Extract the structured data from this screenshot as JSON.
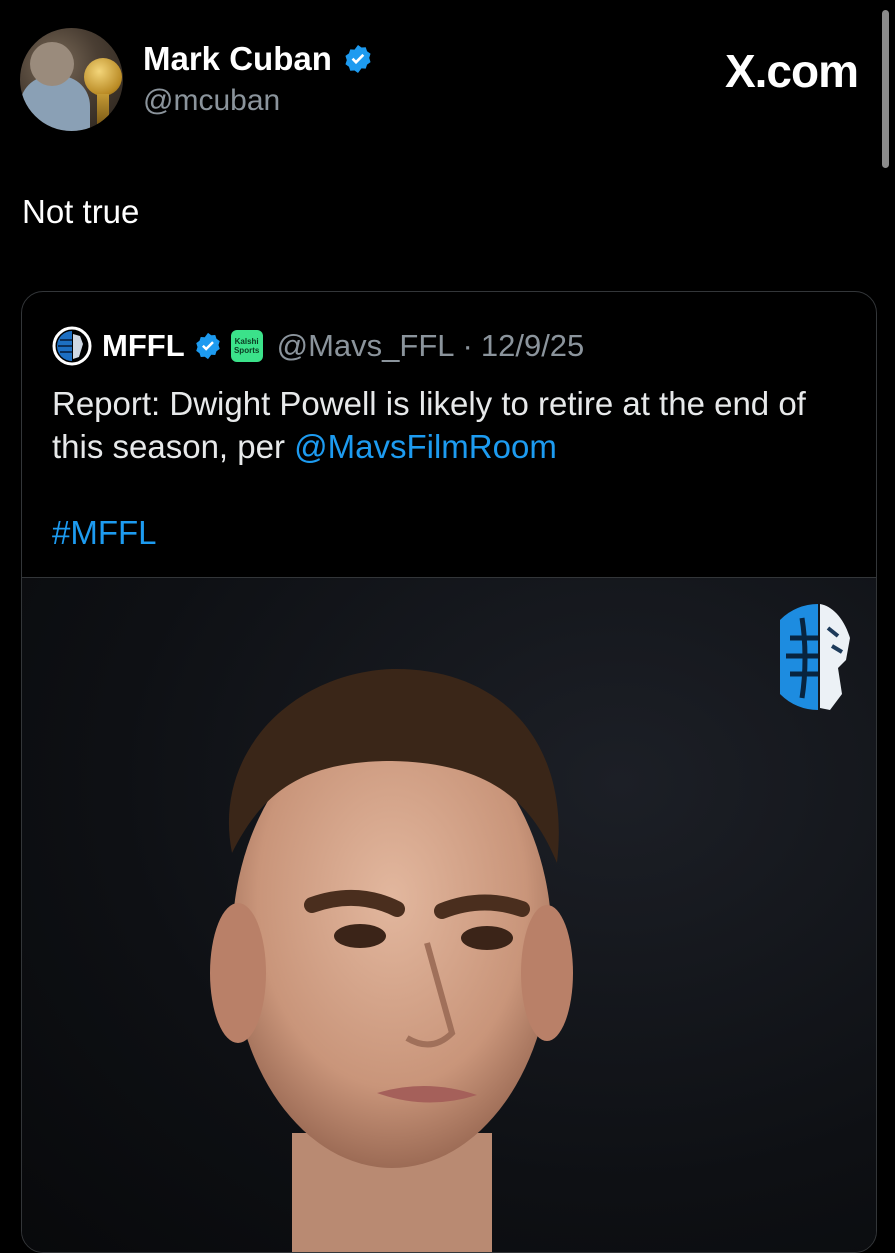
{
  "post": {
    "author_name": "Mark Cuban",
    "author_handle": "@mcuban",
    "text": "Not true"
  },
  "brand": "X.com",
  "quoted": {
    "author_name": "MFFL",
    "sponsor_badge": "Kalshi Sports",
    "author_handle": "@Mavs_FFL",
    "separator": "·",
    "date": "12/9/25",
    "text_before_link": "Report: Dwight Powell is likely to retire at the end of this season, per ",
    "link_text": "@MavsFilmRoom",
    "hashtag": "#MFFL"
  },
  "colors": {
    "background": "#000000",
    "accent": "#1d9bf0",
    "secondary_text": "#8b949c",
    "verified": "#1d9bf0"
  },
  "icons": {
    "verified": "verified-badge-icon",
    "brand_logo": "mffl-logo-icon"
  }
}
